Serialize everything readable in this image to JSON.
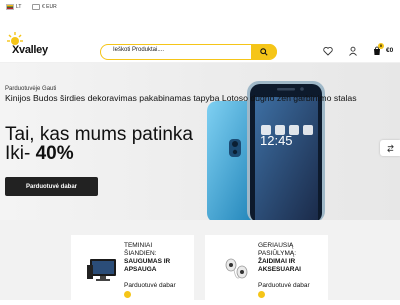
{
  "topbar": {
    "language": "LT",
    "currency": "€ EUR"
  },
  "logo": {
    "text": "Xvalley"
  },
  "search": {
    "placeholder": "Ieškoti Produktai...."
  },
  "cart": {
    "count": "0",
    "total": "€0"
  },
  "hero": {
    "shop_label": "Parduotuvėje Gauti",
    "title": "Kinijos Budos širdies dekoravimas pakabinamas tapyba Lotoso dugno zen garbinimo stalas",
    "promo_line1": "Tai, kas mums patinka",
    "promo_line2_prefix": "Iki-",
    "promo_line2_value": "40%",
    "button": "Parduotuvė dabar",
    "phone_time": "12:45"
  },
  "cards": [
    {
      "line1": "TEMINIAI",
      "line2": "ŠIANDIEN:",
      "line3": "SAUGUMAS IR",
      "line4": "APSAUGA",
      "link": "Parduotuvė dabar"
    },
    {
      "line1": "GERIAUSIĄ",
      "line2": "PASIŪLYMĄ:",
      "line3": "ŽAIDIMAI IR",
      "line4": "AKSESUARAI",
      "link": "Parduotuvė dabar"
    }
  ],
  "colors": {
    "accent": "#f5c518",
    "dark": "#222222"
  }
}
